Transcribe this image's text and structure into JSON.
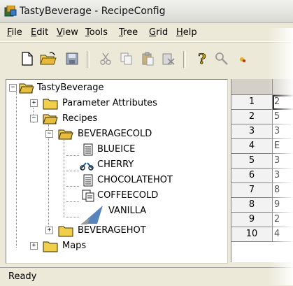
{
  "window": {
    "title": "TastyBeverage - RecipeConfig"
  },
  "menu": {
    "items": [
      {
        "key": "F",
        "rest": "ile"
      },
      {
        "key": "E",
        "rest": "dit"
      },
      {
        "key": "V",
        "rest": "iew"
      },
      {
        "key": "T",
        "rest": "ools"
      },
      {
        "key": "T",
        "rest": "ree"
      },
      {
        "key": "G",
        "rest": "rid"
      },
      {
        "key": "H",
        "rest": "elp"
      }
    ]
  },
  "toolbar": {
    "icons": [
      "new-icon",
      "open-icon",
      "save-icon",
      "cut-icon",
      "copy-icon",
      "paste-icon",
      "paste-special-icon",
      "help-icon",
      "find-icon",
      "pointer-icon"
    ]
  },
  "tree": {
    "root": "TastyBeverage",
    "parameter_attributes": "Parameter Attributes",
    "recipes": "Recipes",
    "beverage_cold": "BEVERAGECOLD",
    "leaves": [
      "BLUEICE",
      "CHERRY",
      "CHOCOLATEHOT",
      "COFFEECOLD",
      "VANILLA"
    ],
    "beverage_hot": "BEVERAGEHOT",
    "maps": "Maps"
  },
  "grid": {
    "rows": [
      "1",
      "2",
      "3",
      "4",
      "5",
      "6",
      "7",
      "8",
      "9",
      "10"
    ],
    "cells": [
      "2",
      "5",
      "3",
      "E",
      "3",
      "3",
      "8",
      "9",
      "2",
      "4"
    ]
  },
  "status": {
    "text": "Ready"
  },
  "colors": {
    "folder": "#f0c83c",
    "accent": "#3c6ea5"
  }
}
